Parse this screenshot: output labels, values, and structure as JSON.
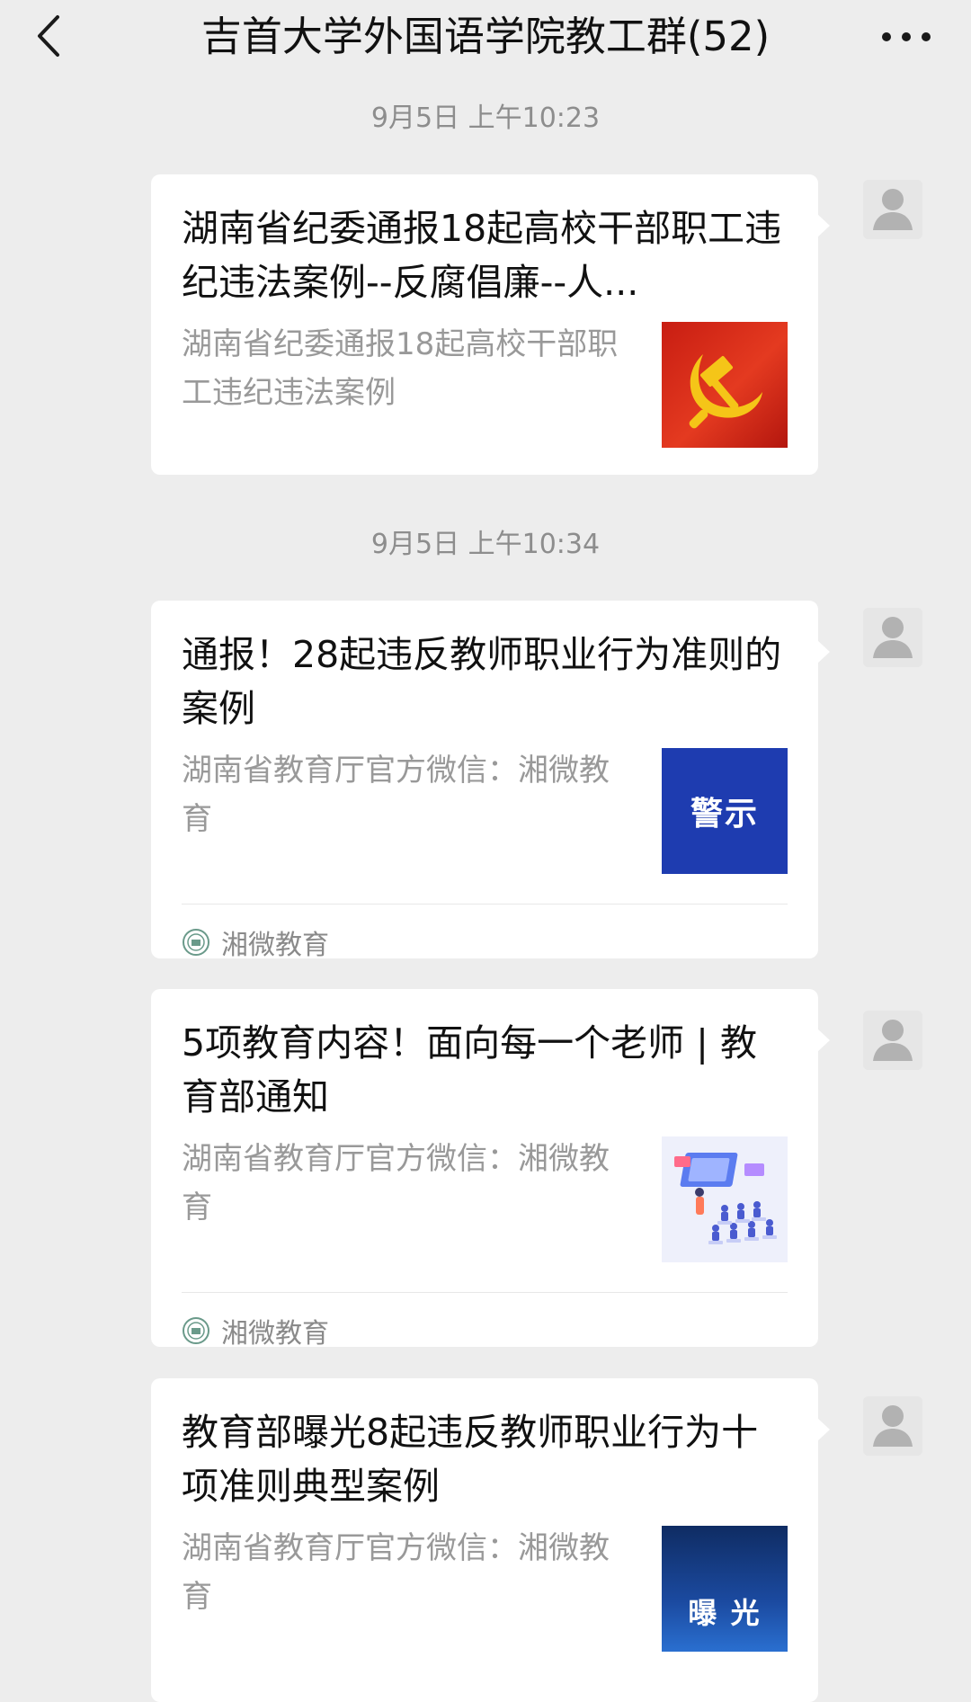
{
  "header": {
    "title": "吉首大学外国语学院教工群(52)",
    "back_icon": "chevron-left-icon",
    "more_icon": "more-dots-icon"
  },
  "messages": [
    {
      "time": "9月5日 上午10:23",
      "title": "湖南省纪委通报18起高校干部职工违纪违法案例--反腐倡廉--人...",
      "desc": "湖南省纪委通报18起高校干部职工违纪违法案例",
      "thumb_icon": "hammer-sickle-icon",
      "avatar_icon": "default-avatar-icon"
    },
    {
      "time": "9月5日 上午10:34",
      "title": "通报！28起违反教师职业行为准则的案例",
      "desc": "湖南省教育厅官方微信：湘微教育",
      "thumb_text": "警示",
      "source": "湘微教育",
      "avatar_icon": "default-avatar-icon"
    },
    {
      "title": "5项教育内容！面向每一个老师 | 教育部通知",
      "desc": "湖南省教育厅官方微信：湘微教育",
      "thumb_icon": "classroom-illustration-icon",
      "source": "湘微教育",
      "avatar_icon": "default-avatar-icon"
    },
    {
      "title": "教育部曝光8起违反教师职业行为十项准则典型案例",
      "desc": "湖南省教育厅官方微信：湘微教育",
      "thumb_text": "曝 光",
      "avatar_icon": "default-avatar-icon"
    }
  ],
  "colors": {
    "background": "#ededed",
    "card": "#ffffff",
    "timestamp": "#8d8d8d",
    "description": "#999999",
    "warning_thumb": "#1e3cb0",
    "party_red": "#d42a1e"
  }
}
